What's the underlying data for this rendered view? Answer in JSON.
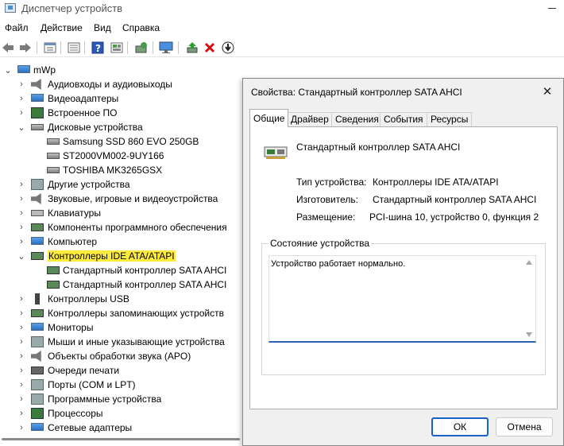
{
  "window": {
    "title": "Диспетчер устройств"
  },
  "menu": [
    "Файл",
    "Действие",
    "Вид",
    "Справка"
  ],
  "toolbar_icons": [
    "back-arrow",
    "forward-arrow",
    "properties",
    "list-view",
    "help",
    "grid",
    "update-driver",
    "monitor",
    "enable-device",
    "remove-device",
    "download-driver"
  ],
  "tree": {
    "root": "mWp",
    "items": [
      {
        "label": "Аудиовходы и аудиовыходы",
        "icon": "speaker"
      },
      {
        "label": "Видеоадаптеры",
        "icon": "monitor"
      },
      {
        "label": "Встроенное ПО",
        "icon": "chip"
      },
      {
        "label": "Дисковые устройства",
        "icon": "disk",
        "expanded": true,
        "children": [
          "Samsung SSD 860 EVO 250GB",
          "ST2000VM002-9UY166",
          "TOSHIBA MK3265GSX"
        ]
      },
      {
        "label": "Другие устройства",
        "icon": "unknown"
      },
      {
        "label": "Звуковые, игровые и видеоустройства",
        "icon": "speaker"
      },
      {
        "label": "Клавиатуры",
        "icon": "keyboard"
      },
      {
        "label": "Компоненты программного обеспечения",
        "icon": "card"
      },
      {
        "label": "Компьютер",
        "icon": "monitor"
      },
      {
        "label": "Контроллеры IDE ATA/ATAPI",
        "icon": "card",
        "expanded": true,
        "selected": true,
        "children": [
          "Стандартный контроллер SATA AHCI",
          "Стандартный контроллер SATA AHCI"
        ]
      },
      {
        "label": "Контроллеры USB",
        "icon": "usb"
      },
      {
        "label": "Контроллеры запоминающих устройств",
        "icon": "card"
      },
      {
        "label": "Мониторы",
        "icon": "monitor"
      },
      {
        "label": "Мыши и иные указывающие устройства",
        "icon": "mouse"
      },
      {
        "label": "Объекты обработки звука (APO)",
        "icon": "speaker"
      },
      {
        "label": "Очереди печати",
        "icon": "printer"
      },
      {
        "label": "Порты (COM и LPT)",
        "icon": "port"
      },
      {
        "label": "Программные устройства",
        "icon": "gray"
      },
      {
        "label": "Процессоры",
        "icon": "chip"
      },
      {
        "label": "Сетевые адаптеры",
        "icon": "monitor"
      }
    ]
  },
  "dialog": {
    "title": "Свойства: Стандартный контроллер SATA AHCI",
    "tabs": [
      "Общие",
      "Драйвер",
      "Сведения",
      "События",
      "Ресурсы"
    ],
    "device_name": "Стандартный контроллер SATA AHCI",
    "props": [
      {
        "label": "Тип устройства:",
        "value": "Контроллеры IDE ATA/ATAPI"
      },
      {
        "label": "Изготовитель:",
        "value": "Стандартный контроллер SATA AHCI"
      },
      {
        "label": "Размещение:",
        "value": "PCI-шина 10, устройство 0, функция 2"
      }
    ],
    "status_group": "Состояние устройства",
    "status_text": "Устройство работает нормально.",
    "ok": "ОК",
    "cancel": "Отмена"
  }
}
